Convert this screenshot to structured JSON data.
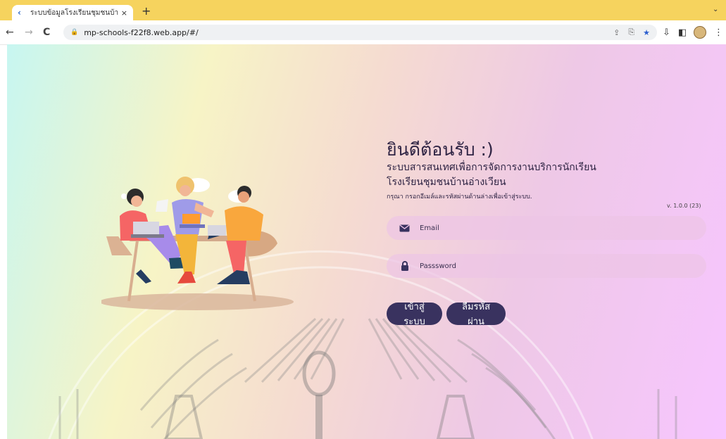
{
  "browser": {
    "tab": {
      "title": "ระบบข้อมูลโรงเรียนชุมชนบ้านอ่างเวียน",
      "close": "×",
      "favicon_icon": "chevron-left-icon"
    },
    "new_tab": "+",
    "tab_menu": "⌄",
    "nav": {
      "back": "←",
      "forward": "→",
      "reload": "C"
    },
    "url": "mp-schools-f22f8.web.app/#/",
    "omnibox_icons": {
      "translate": "⇪",
      "share": "⎘",
      "star": "★"
    },
    "toolbar_icons": {
      "download": "⇩",
      "side_panel": "◧",
      "menu": "⋮"
    }
  },
  "login": {
    "welcome": "ยินดีต้อนรับ :)",
    "system_name": "ระบบสารสนเทศเพื่อการจัดการงานบริการนักเรียน",
    "school_name": "โรงเรียนชุมชนบ้านอ่างเวียน",
    "instruction": "กรุณา กรอกอีเมล์และรหัสผ่านด้านล่างเพื่อเข้าสู่ระบบ.",
    "version": "v. 1.0.0 (23)",
    "email_placeholder": "Email",
    "password_placeholder": "Passsword",
    "login_button": "เข้าสู่ระบบ",
    "forgot_button": "ลืมรหัสผ่าน"
  },
  "colors": {
    "tab_bar": "#f6d35e",
    "primary_button": "#39325f",
    "field_background": "#ecc5e6",
    "accent_star": "#2c5fcf"
  }
}
